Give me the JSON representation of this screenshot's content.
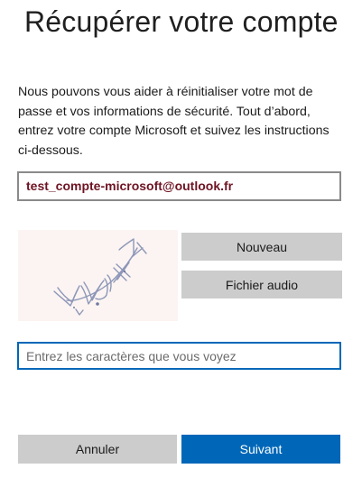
{
  "page": {
    "title": "Récupérer votre compte",
    "description": "Nous pouvons vous aider à réinitialiser votre mot de passe et vos informations de sécurité. Tout d’abord, entrez votre compte Microsoft et suivez les instructions ci-dessous."
  },
  "account": {
    "email": "test_compte-microsoft@outlook.fr"
  },
  "captcha": {
    "image_icon": "captcha-image",
    "new_label": "Nouveau",
    "audio_label": "Fichier audio",
    "input_placeholder": "Entrez les caractères que vous voyez",
    "input_value": ""
  },
  "actions": {
    "cancel_label": "Annuler",
    "next_label": "Suivant"
  },
  "colors": {
    "primary": "#0067b8",
    "secondary_button": "#cccccc",
    "email_text": "#6e1322",
    "captcha_background": "#fcf4f2"
  }
}
